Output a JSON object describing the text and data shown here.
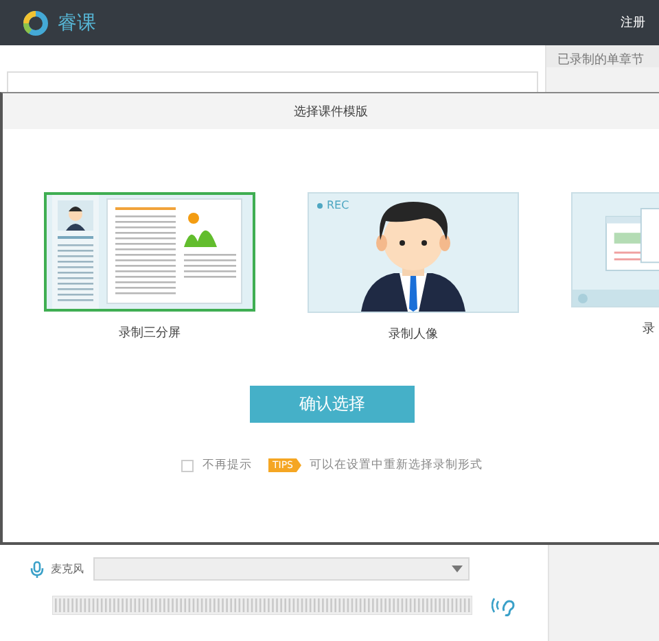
{
  "header": {
    "app_name": "睿课",
    "register_link": "注册"
  },
  "right_panel": {
    "title": "已录制的单章节"
  },
  "dialog": {
    "title": "选择课件模版",
    "templates": [
      {
        "kind": "split",
        "label": "录制三分屏",
        "selected": true
      },
      {
        "kind": "portrait",
        "label": "录制人像",
        "badge": "REC",
        "selected": false
      },
      {
        "kind": "screen",
        "label": "录",
        "selected": false
      }
    ],
    "confirm_button": "确认选择",
    "dont_show": {
      "label": "不再提示",
      "checked": false
    },
    "tips_badge": "TIPS",
    "tips_text": "可以在设置中重新选择录制形式"
  },
  "audio": {
    "mic_label": "麦克风"
  }
}
